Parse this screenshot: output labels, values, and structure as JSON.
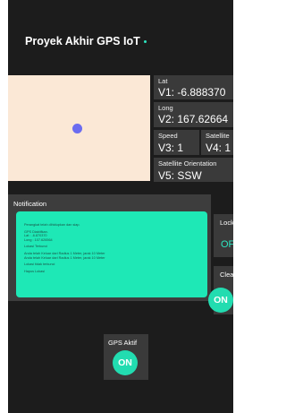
{
  "header": {
    "title": "Proyek Akhir GPS IoT"
  },
  "colors": {
    "background": "#1c1c1c",
    "card": "#3a3a3a",
    "map": "#fbe8d6",
    "accent": "#22dcb0",
    "marker": "#6b6cf0"
  },
  "icons": {
    "status_dot": "status-dot-icon",
    "location_marker": "map-marker-icon"
  },
  "cards": {
    "lat": {
      "label": "Lat",
      "value": "V1: -6.888370"
    },
    "long": {
      "label": "Long",
      "value": "V2: 167.62664"
    },
    "speed": {
      "label": "Speed",
      "value": "V3: 1"
    },
    "satellite": {
      "label": "Satellite",
      "value": "V4: 1"
    },
    "orientation": {
      "label": "Satellite Orientation",
      "value": "V5: SSW"
    }
  },
  "notification": {
    "title": "Notification",
    "lines": [
      "Perangkat telah dihidupkan dan siap.",
      "GPS Diaktifkan.",
      "Lat : -6.870370",
      "Long : 107.626564",
      "Lokasi Terkunci",
      "Anda telah Keluar dari Radius 1 Meter, jarak 10 Meter",
      "Anda telah Keluar dari Radius 1 Meter, jarak 10 Meter",
      "Lokasi tidak terkunci",
      "Hapus Lokasi"
    ]
  },
  "lock": {
    "label": "Lock",
    "value": "OFF"
  },
  "clear": {
    "label": "Clear",
    "value": "ON"
  },
  "gps": {
    "label": "GPS Aktif",
    "value": "ON"
  }
}
